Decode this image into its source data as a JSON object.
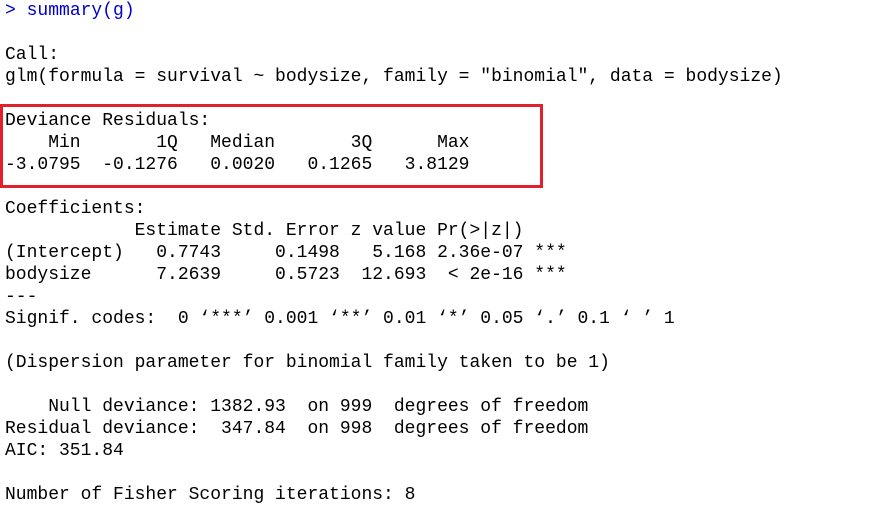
{
  "console": {
    "prompt": "> ",
    "command": "summary(g)",
    "call_header": "Call:",
    "call_text": "glm(formula = survival ~ bodysize, family = \"binomial\", data = bodysize)",
    "deviance_residuals": {
      "title": "Deviance Residuals:",
      "header": "    Min       1Q   Median       3Q      Max  ",
      "values": "-3.0795  -0.1276   0.0020   0.1265   3.8129  "
    },
    "coefficients": {
      "title": "Coefficients:",
      "header": "            Estimate Std. Error z value Pr(>|z|)    ",
      "row1": "(Intercept)   0.7743     0.1498   5.168 2.36e-07 ***",
      "row2": "bodysize      7.2639     0.5723  12.693  < 2e-16 ***",
      "separator": "---",
      "signif": "Signif. codes:  0 ‘***’ 0.001 ‘**’ 0.01 ‘*’ 0.05 ‘.’ 0.1 ‘ ’ 1"
    },
    "dispersion": "(Dispersion parameter for binomial family taken to be 1)",
    "null_deviance": "    Null deviance: 1382.93  on 999  degrees of freedom",
    "residual_deviance": "Residual deviance:  347.84  on 998  degrees of freedom",
    "aic": "AIC: 351.84",
    "fisher": "Number of Fisher Scoring iterations: 8"
  },
  "colors": {
    "command": "#0000cc",
    "text": "#000000",
    "highlight_border": "#e0202a"
  }
}
